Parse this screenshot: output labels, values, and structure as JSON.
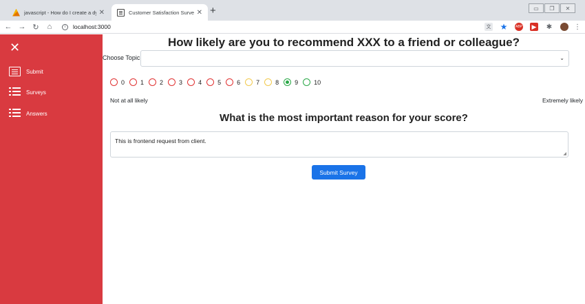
{
  "browser": {
    "tabs": [
      {
        "title": "javascript - How do I create a dyna",
        "active": false
      },
      {
        "title": "Customer Satisfaction Survey",
        "active": true
      }
    ],
    "url": "localhost:3000",
    "colors": {
      "tabbar": "#dee1e6",
      "star": "#1a73e8"
    }
  },
  "sidebar": {
    "color": "#d93a40",
    "items": [
      {
        "label": "Submit",
        "icon": "form-icon"
      },
      {
        "label": "Surveys",
        "icon": "list-icon"
      },
      {
        "label": "Answers",
        "icon": "list-icon"
      }
    ]
  },
  "survey": {
    "question": "How likely are you to recommend XXX to a friend or colleague?",
    "topic_label": "Choose Topic:",
    "topic_value": "",
    "scale": [
      {
        "value": "0",
        "color": "#e03131"
      },
      {
        "value": "1",
        "color": "#e03131"
      },
      {
        "value": "2",
        "color": "#e03131"
      },
      {
        "value": "3",
        "color": "#e03131"
      },
      {
        "value": "4",
        "color": "#e03131"
      },
      {
        "value": "5",
        "color": "#e03131"
      },
      {
        "value": "6",
        "color": "#e03131"
      },
      {
        "value": "7",
        "color": "#f2c94c"
      },
      {
        "value": "8",
        "color": "#f2c94c"
      },
      {
        "value": "9",
        "color": "#28a745"
      },
      {
        "value": "10",
        "color": "#28a745"
      }
    ],
    "selected": "9",
    "low_label": "Not at all likely",
    "high_label": "Extremely likely",
    "reason_question": "What is the most important reason for your score?",
    "reason_text": "This is frontend request from client.",
    "submit_label": "Submit Survey",
    "accent_color": "#1a73e8"
  }
}
